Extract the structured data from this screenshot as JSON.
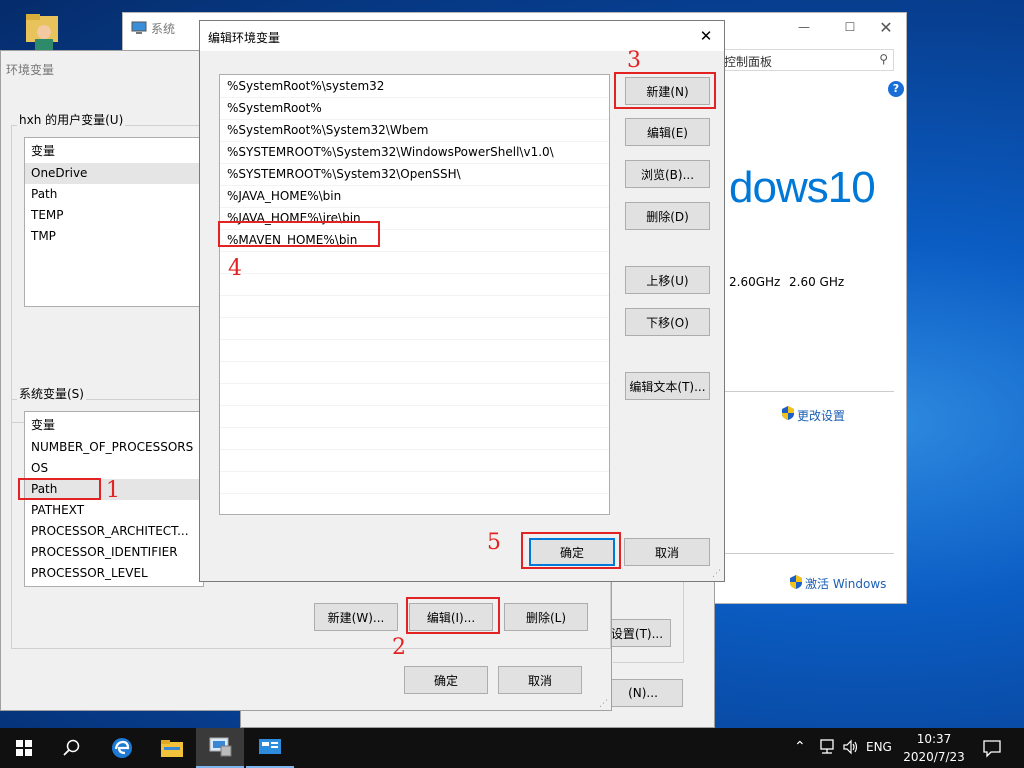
{
  "desktop": {
    "recycle_label": ""
  },
  "system_window": {
    "title": "系统",
    "address_tail": "控制面板",
    "win_brand": "dows10",
    "cpu_speed_1": "2.60GHz",
    "cpu_speed_2": "2.60 GHz",
    "change_settings": "更改设置",
    "activate_windows": "激活 Windows",
    "btn_settings": "设置(T)...",
    "btn_new": "(N)..."
  },
  "env_window": {
    "title": "环境变量",
    "user_group": "hxh 的用户变量(U)",
    "user_col": "变量",
    "user_vars": [
      "OneDrive",
      "Path",
      "TEMP",
      "TMP"
    ],
    "sys_group": "系统变量(S)",
    "sys_col": "变量",
    "sys_vars": [
      "NUMBER_OF_PROCESSORS",
      "OS",
      "Path",
      "PATHEXT",
      "PROCESSOR_ARCHITECT...",
      "PROCESSOR_IDENTIFIER",
      "PROCESSOR_LEVEL"
    ],
    "btn_new": "新建(W)...",
    "btn_edit": "编辑(I)...",
    "btn_delete": "删除(L)",
    "btn_ok": "确定",
    "btn_cancel": "取消"
  },
  "edit_dialog": {
    "title": "编辑环境变量",
    "paths": [
      "%SystemRoot%\\system32",
      "%SystemRoot%",
      "%SystemRoot%\\System32\\Wbem",
      "%SYSTEMROOT%\\System32\\WindowsPowerShell\\v1.0\\",
      "%SYSTEMROOT%\\System32\\OpenSSH\\",
      "%JAVA_HOME%\\bin",
      "%JAVA_HOME%\\jre\\bin",
      "%MAVEN_HOME%\\bin"
    ],
    "btn_new": "新建(N)",
    "btn_edit": "编辑(E)",
    "btn_browse": "浏览(B)...",
    "btn_delete": "删除(D)",
    "btn_up": "上移(U)",
    "btn_down": "下移(O)",
    "btn_edit_text": "编辑文本(T)...",
    "btn_ok": "确定",
    "btn_cancel": "取消"
  },
  "annotations": [
    "1",
    "2",
    "3",
    "4",
    "5"
  ],
  "taskbar": {
    "language": "ENG",
    "time": "10:37",
    "date": "2020/7/23"
  },
  "colors": {
    "accent": "#0078d7",
    "annotation": "#e32323",
    "taskbar": "#101010"
  }
}
